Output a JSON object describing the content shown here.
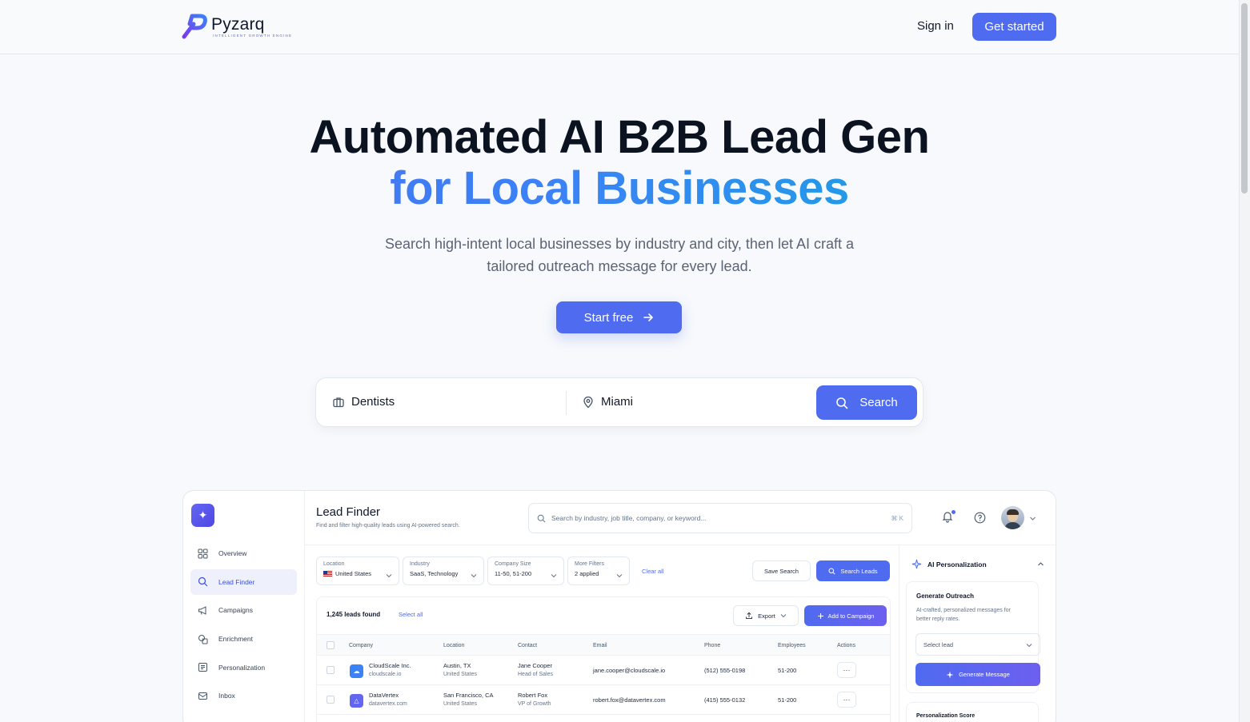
{
  "brand": {
    "name": "Pyzarq",
    "tagline": "INTELLIGENT GROWTH ENGINE"
  },
  "nav": {
    "signin": "Sign in",
    "get_started": "Get started"
  },
  "hero": {
    "title_line1": "Automated AI B2B Lead Gen",
    "title_line2": "for Local Businesses",
    "subtitle_line1": "Search high-intent local businesses by industry and city, then let AI craft a",
    "subtitle_line2": "tailored outreach message for every lead.",
    "cta": "Start free"
  },
  "search": {
    "industry_value": "Dentists",
    "location_value": "Miami",
    "button": "Search"
  },
  "dashboard": {
    "title": "Lead Finder",
    "subtitle": "Find and filter high-quality leads using AI-powered search.",
    "search_placeholder": "Search by industry, job title, company, or keyword...",
    "search_shortcut": "⌘ K",
    "sidebar": [
      {
        "label": "Overview",
        "icon": "grid-icon"
      },
      {
        "label": "Lead Finder",
        "icon": "search-icon",
        "active": true
      },
      {
        "label": "Campaigns",
        "icon": "megaphone-icon"
      },
      {
        "label": "Enrichment",
        "icon": "layers-icon"
      },
      {
        "label": "Personalization",
        "icon": "sliders-icon"
      },
      {
        "label": "Inbox",
        "icon": "inbox-icon"
      }
    ],
    "filters": [
      {
        "label": "Location",
        "value": "United States"
      },
      {
        "label": "Industry",
        "value": "SaaS, Technology"
      },
      {
        "label": "Company Size",
        "value": "11-50, 51-200"
      },
      {
        "label": "More Filters",
        "value": "2 applied"
      }
    ],
    "clear_all": "Clear all",
    "save_search": "Save Search",
    "search_leads": "Search Leads",
    "leads_found": "1,245 leads found",
    "select_all": "Select all",
    "export": "Export",
    "add_to_campaign": "Add to Campaign",
    "columns": [
      "Company",
      "Location",
      "Contact",
      "Email",
      "Phone",
      "Employees",
      "Actions"
    ],
    "rows": [
      {
        "company": "CloudScale Inc.",
        "domain": "cloudscale.io",
        "city": "Austin, TX",
        "country": "United States",
        "contact": "Jane Cooper",
        "role": "Head of Sales",
        "email": "jane.cooper@cloudscale.io",
        "phone": "(512) 555-0198",
        "employees": "51-200",
        "logo_color": "#3b82f6"
      },
      {
        "company": "DataVertex",
        "domain": "datavertex.com",
        "city": "San Francisco, CA",
        "country": "United States",
        "contact": "Robert Fox",
        "role": "VP of Growth",
        "email": "robert.fox@datavertex.com",
        "phone": "(415) 555-0132",
        "employees": "51-200",
        "logo_color": "#6366f1"
      }
    ],
    "ai": {
      "title": "AI Personalization",
      "card_title": "Generate Outreach",
      "card_desc": "AI-crafted, personalized messages for better reply rates.",
      "select_placeholder": "Select lead",
      "generate": "Generate Message",
      "score_title": "Personalization Score"
    }
  },
  "colors": {
    "accent": "#4f6bef",
    "gradient_end": "#06b6d4"
  }
}
